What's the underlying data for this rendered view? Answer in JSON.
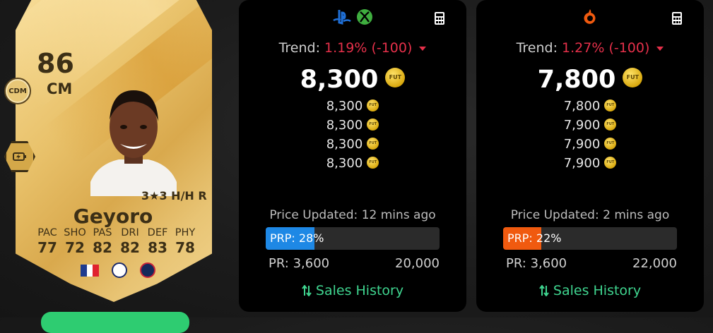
{
  "card": {
    "rating": "86",
    "position": "CM",
    "alt_position": "CDM",
    "skills": "3★3 H/H R",
    "name": "Geyoro",
    "stats": [
      {
        "label": "PAC",
        "value": "77"
      },
      {
        "label": "SHO",
        "value": "72"
      },
      {
        "label": "PAS",
        "value": "82"
      },
      {
        "label": "DRI",
        "value": "82"
      },
      {
        "label": "DEF",
        "value": "83"
      },
      {
        "label": "PHY",
        "value": "78"
      }
    ],
    "playstyle_icon": "lightning-playstyle-icon",
    "nation_icon": "france-flag-icon",
    "league_icon": "league-badge-icon",
    "club_icon": "psg-badge-icon"
  },
  "console_panel": {
    "platform_icons": [
      "playstation-icon",
      "xbox-icon"
    ],
    "trend_label": "Trend:",
    "trend_value": "1.19% (-100)",
    "price": "8,300",
    "recent_prices": [
      "8,300",
      "8,300",
      "8,300",
      "8,300"
    ],
    "updated": "Price Updated: 12 mins ago",
    "prp_text": "PRP: 28%",
    "prp_percent": 28,
    "prp_color": "#1e88e5",
    "pr_min": "PR: 3,600",
    "pr_max": "20,000",
    "sales_label": "Sales History"
  },
  "pc_panel": {
    "platform_icons": [
      "origin-icon"
    ],
    "trend_label": "Trend:",
    "trend_value": "1.27% (-100)",
    "price": "7,800",
    "recent_prices": [
      "7,800",
      "7,900",
      "7,900",
      "7,900"
    ],
    "updated": "Price Updated: 2 mins ago",
    "prp_text": "PRP: 22%",
    "prp_percent": 22,
    "prp_color": "#f05a0f",
    "pr_min": "PR: 3,600",
    "pr_max": "22,000",
    "sales_label": "Sales History"
  },
  "coin_label": "FUT",
  "colors": {
    "trend_negative": "#e5304a",
    "sales_link": "#3fd48f",
    "card_gold": "#e9c26b",
    "panel_bg": "#000000"
  }
}
